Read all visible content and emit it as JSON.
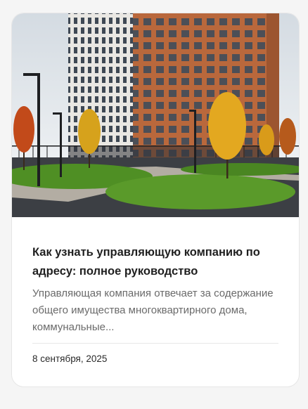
{
  "article": {
    "title": "Как узнать управляющую компанию по адресу: полное руководство",
    "excerpt": "Управляющая компания отвечает за содержание общего имущества многоквартирного дома, коммунальные...",
    "date": "8 сентября, 2025"
  },
  "colors": {
    "card_background": "#ffffff",
    "page_background": "#f5f5f5",
    "title_text": "#1f1f1f",
    "excerpt_text": "#6a6a6a",
    "brick_facade": "#b9683c",
    "white_facade": "#e9e7e3",
    "autumn_foliage": "#e3a820",
    "lawn": "#4f8f24"
  }
}
